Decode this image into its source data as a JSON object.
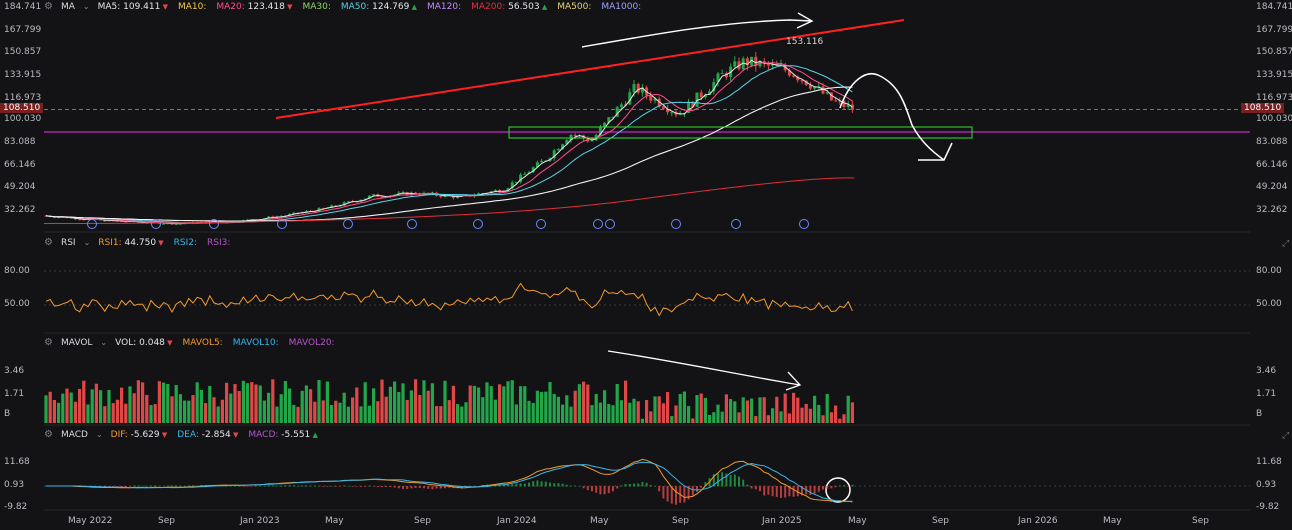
{
  "colors": {
    "up": "#23a54a",
    "down": "#e04848",
    "ma5": "#e6e6e6",
    "ma20": "#ff4d8d",
    "ma50": "#5ad3e6",
    "ma200": "#e0303a",
    "ma500": "#f2f2f2",
    "rsi": "#f29a2e",
    "dif": "#f29a2e",
    "dea": "#38b6e8",
    "support": "#cc22cc",
    "price_line": "#e05020",
    "trend": "#ff2020",
    "zone": "#30e030",
    "drawing": "#ffffff"
  },
  "main": {
    "indicator": "MA",
    "legend": [
      {
        "label": "MA5:",
        "value": "109.411",
        "dir": "down"
      },
      {
        "label": "MA10:",
        "value": "",
        "dir": ""
      },
      {
        "label": "MA20:",
        "value": "123.418",
        "dir": "down"
      },
      {
        "label": "MA30:",
        "value": "",
        "dir": ""
      },
      {
        "label": "MA50:",
        "value": "124.769",
        "dir": "up"
      },
      {
        "label": "MA120:",
        "value": "",
        "dir": ""
      },
      {
        "label": "MA200:",
        "value": "56.503",
        "dir": "up"
      },
      {
        "label": "MA500:",
        "value": "",
        "dir": ""
      },
      {
        "label": "MA1000:",
        "value": "",
        "dir": ""
      }
    ],
    "current_price": "108.510",
    "peak_label": "153.116",
    "y_ticks": [
      "184.741",
      "167.799",
      "150.857",
      "133.915",
      "116.973",
      "100.030",
      "83.088",
      "66.146",
      "49.204",
      "32.262"
    ]
  },
  "rsi_panel": {
    "indicator": "RSI",
    "legend": [
      {
        "label": "RSI1:",
        "value": "44.750",
        "dir": "down"
      },
      {
        "label": "RSI2:",
        "value": "",
        "dir": ""
      },
      {
        "label": "RSI3:",
        "value": "",
        "dir": ""
      }
    ],
    "y_ticks": [
      "80.00",
      "50.00"
    ]
  },
  "vol_panel": {
    "indicator": "MAVOL",
    "legend": [
      {
        "label": "VOL:",
        "value": "0.048",
        "dir": "down"
      },
      {
        "label": "MAVOL5:",
        "value": "",
        "dir": ""
      },
      {
        "label": "MAVOL10:",
        "value": "",
        "dir": ""
      },
      {
        "label": "MAVOL20:",
        "value": "",
        "dir": ""
      }
    ],
    "y_ticks": [
      "3.46",
      "1.71",
      "B"
    ]
  },
  "macd_panel": {
    "indicator": "MACD",
    "legend": [
      {
        "label": "DIF:",
        "value": "-5.629",
        "dir": "down"
      },
      {
        "label": "DEA:",
        "value": "-2.854",
        "dir": "down"
      },
      {
        "label": "MACD:",
        "value": "-5.551",
        "dir": "up"
      }
    ],
    "y_ticks": [
      "11.68",
      "0.93",
      "-9.82"
    ]
  },
  "x_ticks": [
    "May 2022",
    "Sep",
    "Jan 2023",
    "May",
    "Sep",
    "Jan 2024",
    "May",
    "Sep",
    "Jan 2025",
    "May",
    "Sep",
    "Jan 2026",
    "May",
    "Sep"
  ],
  "chart_data": {
    "type": "candlestick",
    "x_period": [
      "2022-03",
      "2025-04"
    ],
    "price_anchors": [
      {
        "t": "2022-03",
        "close": 28
      },
      {
        "t": "2022-06",
        "close": 24
      },
      {
        "t": "2022-09",
        "close": 22
      },
      {
        "t": "2022-12",
        "close": 24
      },
      {
        "t": "2023-02",
        "close": 28
      },
      {
        "t": "2023-04",
        "close": 34
      },
      {
        "t": "2023-06",
        "close": 43
      },
      {
        "t": "2023-08",
        "close": 45
      },
      {
        "t": "2023-10",
        "close": 42
      },
      {
        "t": "2023-12",
        "close": 48
      },
      {
        "t": "2024-02",
        "close": 72
      },
      {
        "t": "2024-03",
        "close": 90
      },
      {
        "t": "2024-04",
        "close": 85
      },
      {
        "t": "2024-05",
        "close": 105
      },
      {
        "t": "2024-06",
        "close": 125
      },
      {
        "t": "2024-08",
        "close": 105
      },
      {
        "t": "2024-10",
        "close": 135
      },
      {
        "t": "2024-11",
        "close": 145
      },
      {
        "t": "2025-01",
        "close": 138
      },
      {
        "t": "2025-02",
        "close": 128
      },
      {
        "t": "2025-03",
        "close": 115
      },
      {
        "t": "2025-04",
        "close": 108.51
      }
    ],
    "peak": 153.116,
    "current": 108.51,
    "ma_values": {
      "MA5": 109.411,
      "MA20": 123.418,
      "MA50": 124.769,
      "MA200": 56.503
    },
    "rsi_last": 44.75,
    "macd": {
      "DIF": -5.629,
      "DEA": -2.854,
      "MACD": -5.551
    },
    "volume_last": 0.048
  }
}
